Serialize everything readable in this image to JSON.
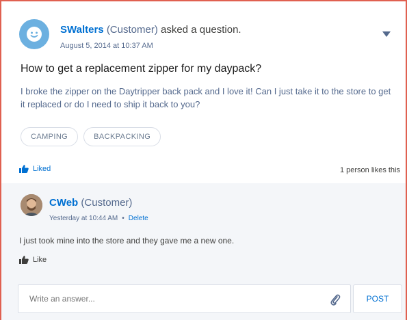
{
  "question": {
    "author": "SWalters",
    "role": "(Customer)",
    "action": "asked a question.",
    "timestamp": "August 5, 2014 at 10:37 AM",
    "title": "How to get a replacement zipper for my daypack?",
    "body": "I broke the zipper on the Daytripper back pack and I love it! Can I just take it to the store to get it replaced or do I need to ship it back to you?",
    "tags": [
      "CAMPING",
      "BACKPACKING"
    ],
    "liked_label": "Liked",
    "like_count": "1 person likes this"
  },
  "answer": {
    "author": "CWeb",
    "role": "(Customer)",
    "timestamp": "Yesterday at 10:44 AM",
    "separator": "•",
    "delete_label": "Delete",
    "body": "I just took mine into the store and they gave me a new one.",
    "like_label": "Like"
  },
  "composer": {
    "placeholder": "Write an answer...",
    "post_label": "POST"
  },
  "colors": {
    "accent": "#0070d2",
    "frame": "#e06050",
    "answers_bg": "#f4f6f9"
  },
  "icons": {
    "question_avatar": "smiley-face-icon",
    "menu": "chevron-down-icon",
    "like": "thumbs-up-icon",
    "attach": "paperclip-icon"
  }
}
